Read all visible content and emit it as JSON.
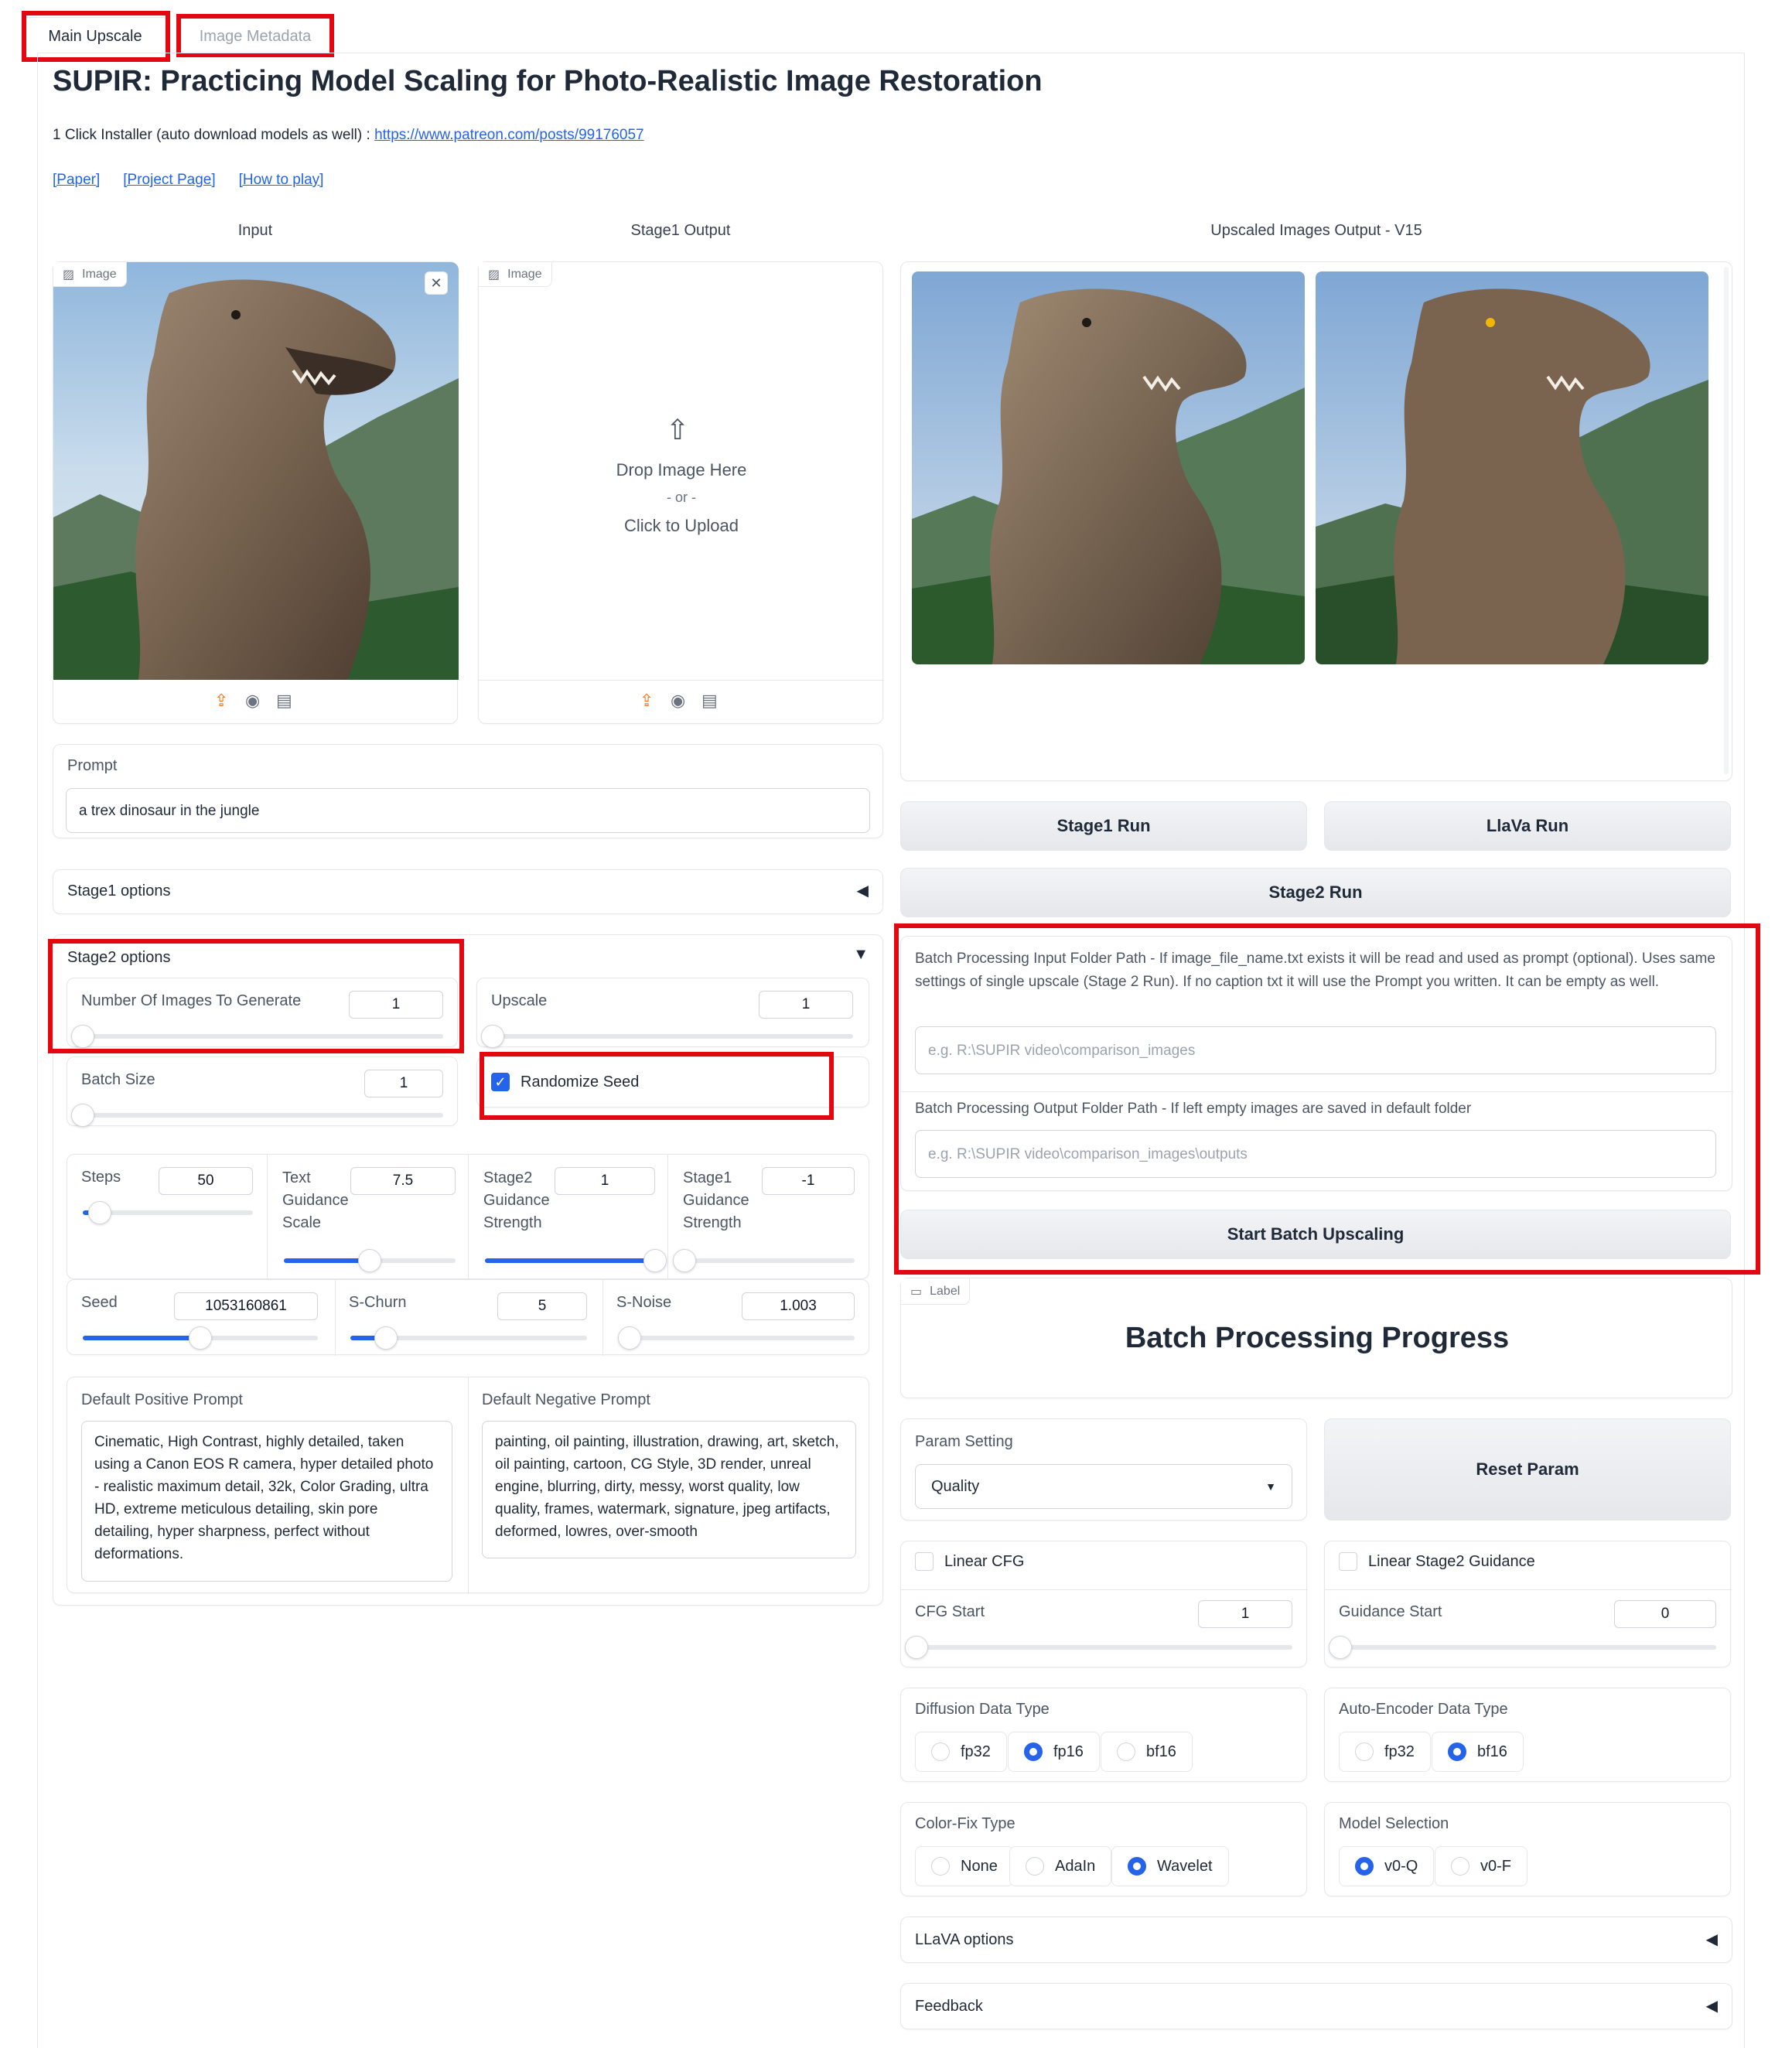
{
  "tabs": [
    {
      "label": "Main Upscale"
    },
    {
      "label": "Image Metadata"
    }
  ],
  "header": {
    "title": "SUPIR: Practicing Model Scaling for Photo-Realistic Image Restoration",
    "installer_text": "1 Click Installer (auto download models as well) : ",
    "installer_link": "https://www.patreon.com/posts/99176057",
    "links": [
      "[Paper]",
      "[Project Page]",
      "[How to play]"
    ]
  },
  "columns": {
    "input": "Input",
    "stage1": "Stage1 Output",
    "upscaled": "Upscaled Images Output - V15"
  },
  "image_label": "Image",
  "upload": {
    "drop": "Drop Image Here",
    "or": "- or -",
    "click": "Click to Upload"
  },
  "prompt": {
    "label": "Prompt",
    "value": "a trex dinosaur in the jungle"
  },
  "stage1_options": "Stage1 options",
  "stage2": {
    "label": "Stage2 options",
    "num_images": {
      "label": "Number Of Images To Generate",
      "value": "1"
    },
    "upscale": {
      "label": "Upscale",
      "value": "1"
    },
    "batch_size": {
      "label": "Batch Size",
      "value": "1"
    },
    "randomize_seed": {
      "label": "Randomize Seed",
      "checked": true
    },
    "steps": {
      "label": "Steps",
      "value": "50"
    },
    "text_guidance": {
      "label_lines": [
        "Text",
        "Guidance",
        "Scale"
      ],
      "value": "7.5"
    },
    "stage2_guidance": {
      "label_lines": [
        "Stage2",
        "Guidance",
        "Strength"
      ],
      "value": "1"
    },
    "stage1_guidance": {
      "label_lines": [
        "Stage1",
        "Guidance",
        "Strength"
      ],
      "value": "-1"
    },
    "seed": {
      "label": "Seed",
      "value": "1053160861"
    },
    "s_churn": {
      "label": "S-Churn",
      "value": "5"
    },
    "s_noise": {
      "label": "S-Noise",
      "value": "1.003"
    },
    "pos_prompt": {
      "label": "Default Positive Prompt",
      "value": "Cinematic, High Contrast, highly detailed, taken using a Canon EOS R camera, hyper detailed photo - realistic maximum detail, 32k, Color Grading, ultra HD, extreme meticulous detailing, skin pore detailing, hyper sharpness, perfect without deformations."
    },
    "neg_prompt": {
      "label": "Default Negative Prompt",
      "value": "painting, oil painting, illustration, drawing, art, sketch, oil painting, cartoon, CG Style, 3D render, unreal engine, blurring, dirty, messy, worst quality, low quality, frames, watermark, signature, jpeg artifacts, deformed, lowres, over-smooth"
    }
  },
  "buttons": {
    "stage1_run": "Stage1 Run",
    "llava_run": "LlaVa Run",
    "stage2_run": "Stage2 Run",
    "batch": "Start Batch Upscaling",
    "reset": "Reset Param"
  },
  "batch": {
    "input_label": "Batch Processing Input Folder Path - If image_file_name.txt exists it will be read and used as prompt (optional). Uses same settings of single upscale (Stage 2 Run). If no caption txt it will use the Prompt you written. It can be empty as well.",
    "input_placeholder": "e.g. R:\\SUPIR video\\comparison_images",
    "output_label": "Batch Processing Output Folder Path - If left empty images are saved in default folder",
    "output_placeholder": "e.g. R:\\SUPIR video\\comparison_images\\outputs"
  },
  "progress": {
    "tag": "Label",
    "title": "Batch Processing Progress"
  },
  "param_setting": {
    "label": "Param Setting",
    "value": "Quality"
  },
  "linear_cfg": {
    "label": "Linear CFG",
    "checked": false
  },
  "linear_stage2": {
    "label": "Linear Stage2 Guidance",
    "checked": false
  },
  "cfg_start": {
    "label": "CFG Start",
    "value": "1"
  },
  "guidance_start": {
    "label": "Guidance Start",
    "value": "0"
  },
  "diffusion": {
    "label": "Diffusion Data Type",
    "options": [
      "fp32",
      "fp16",
      "bf16"
    ],
    "selected": "fp16"
  },
  "autoencoder": {
    "label": "Auto-Encoder Data Type",
    "options": [
      "fp32",
      "bf16"
    ],
    "selected": "bf16"
  },
  "colorfix": {
    "label": "Color-Fix Type",
    "options": [
      "None",
      "AdaIn",
      "Wavelet"
    ],
    "selected": "Wavelet"
  },
  "model": {
    "label": "Model Selection",
    "options": [
      "v0-Q",
      "v0-F"
    ],
    "selected": "v0-Q"
  },
  "llava_options": "LLaVA options",
  "feedback": "Feedback",
  "colors": {
    "accent": "#2563eb",
    "highlight": "#e5070f",
    "upload_icon": "#f97316"
  },
  "sliders": {
    "num_images": 0,
    "upscale": 0,
    "batch_size": 0,
    "steps": 0.1,
    "text_guidance": 0.5,
    "stage2_guidance": 1.0,
    "stage1_guidance": 0,
    "seed": 0.5,
    "s_churn": 0.15,
    "s_noise": 0.05,
    "cfg_start": 0,
    "guidance_start": 0
  }
}
